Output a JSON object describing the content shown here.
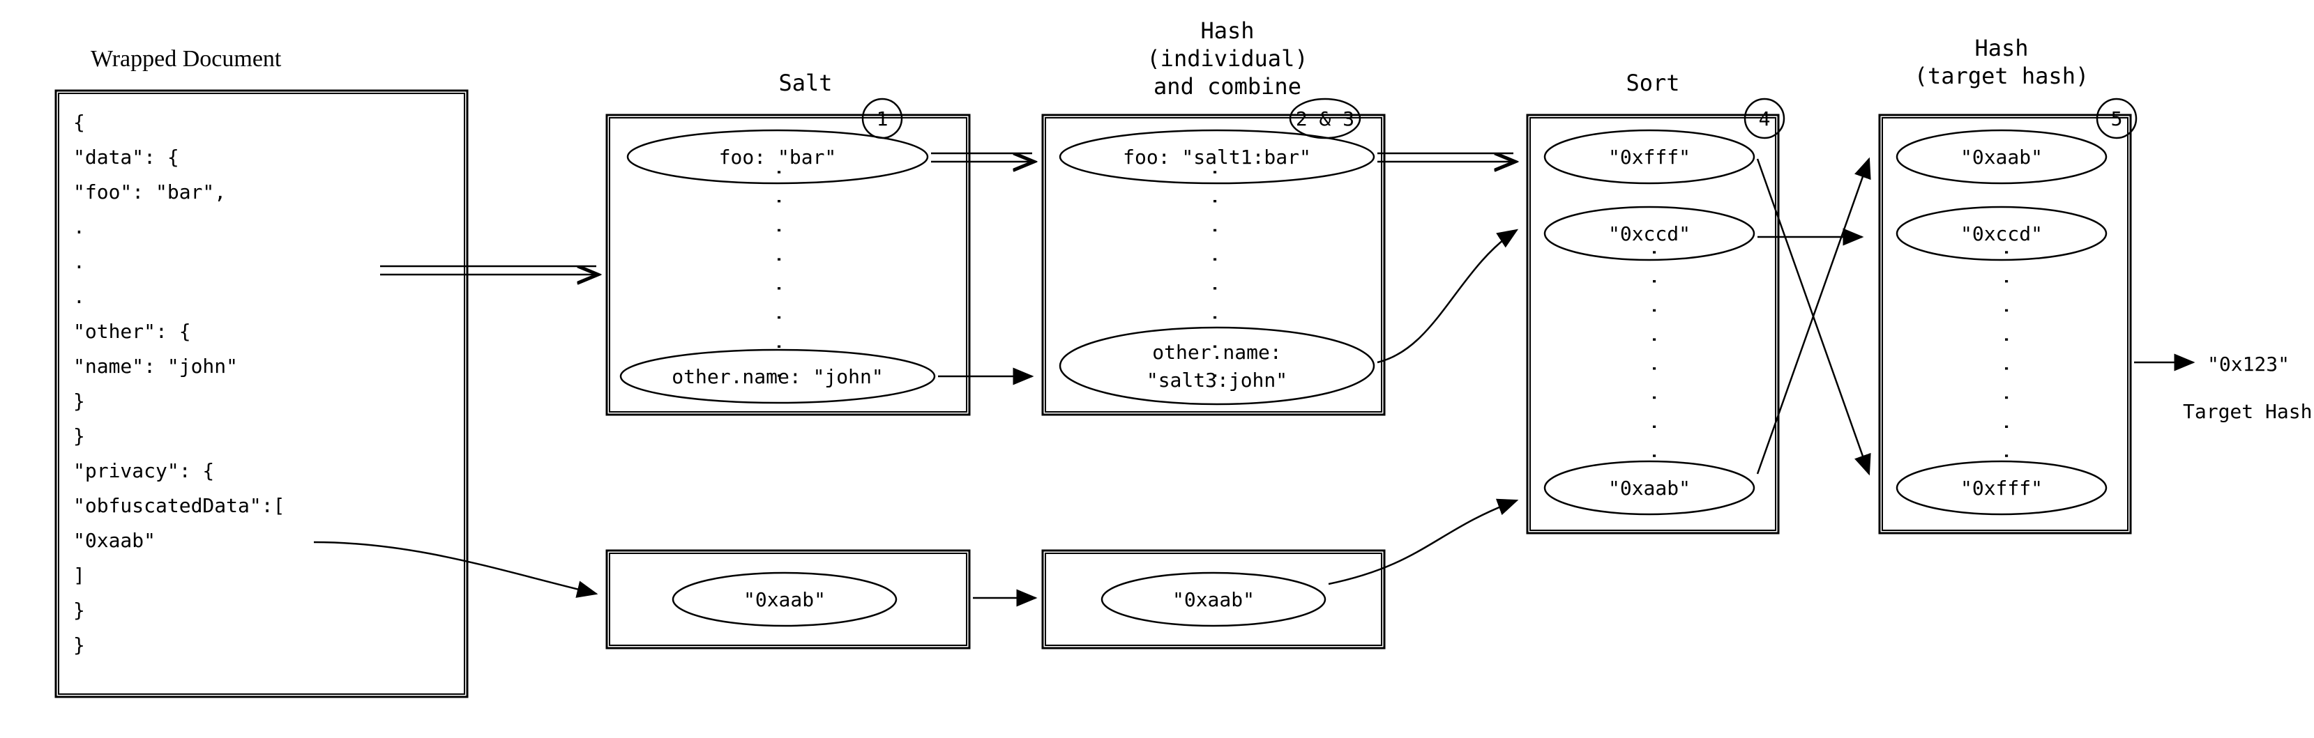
{
  "titles": {
    "wrapped": "Wrapped Document",
    "salt": "Salt",
    "hashCombine1": "Hash",
    "hashCombine2": "(individual)",
    "hashCombine3": "and combine",
    "sort": "Sort",
    "targetHash1": "Hash",
    "targetHash2": "(target hash)"
  },
  "steps": {
    "s1": "1",
    "s23": "2 & 3",
    "s4": "4",
    "s5": "5"
  },
  "doc": {
    "l1": "{",
    "l2": "  \"data\": {",
    "l3": "    \"foo\": \"bar\",",
    "l4": "  .",
    "l5": "  .",
    "l6": "  .",
    "l7": "    \"other\": {",
    "l8": "      \"name\": \"john\"",
    "l9": "    }",
    "l10": "  }",
    "l11": "  \"privacy\": {",
    "l12": "    \"obfuscatedData\":[",
    "l13": "      \"0xaab\"",
    "l14": "    ]",
    "l15": "  }",
    "l16": "}"
  },
  "col1": {
    "top": "foo: \"bar\"",
    "bot": "other.name: \"john\"",
    "obfs": "\"0xaab\""
  },
  "col2": {
    "top": "foo: \"salt1:bar\"",
    "botA": "other.name:",
    "botB": "\"salt3:john\"",
    "obfs": "\"0xaab\""
  },
  "col3": {
    "a": "\"0xfff\"",
    "b": "\"0xccd\"",
    "c": "\"0xaab\""
  },
  "col4": {
    "a": "\"0xaab\"",
    "b": "\"0xccd\"",
    "c": "\"0xfff\""
  },
  "result": {
    "value": "\"0x123\"",
    "label": "Target Hash"
  },
  "ellipsis": ". . . . . . . ."
}
